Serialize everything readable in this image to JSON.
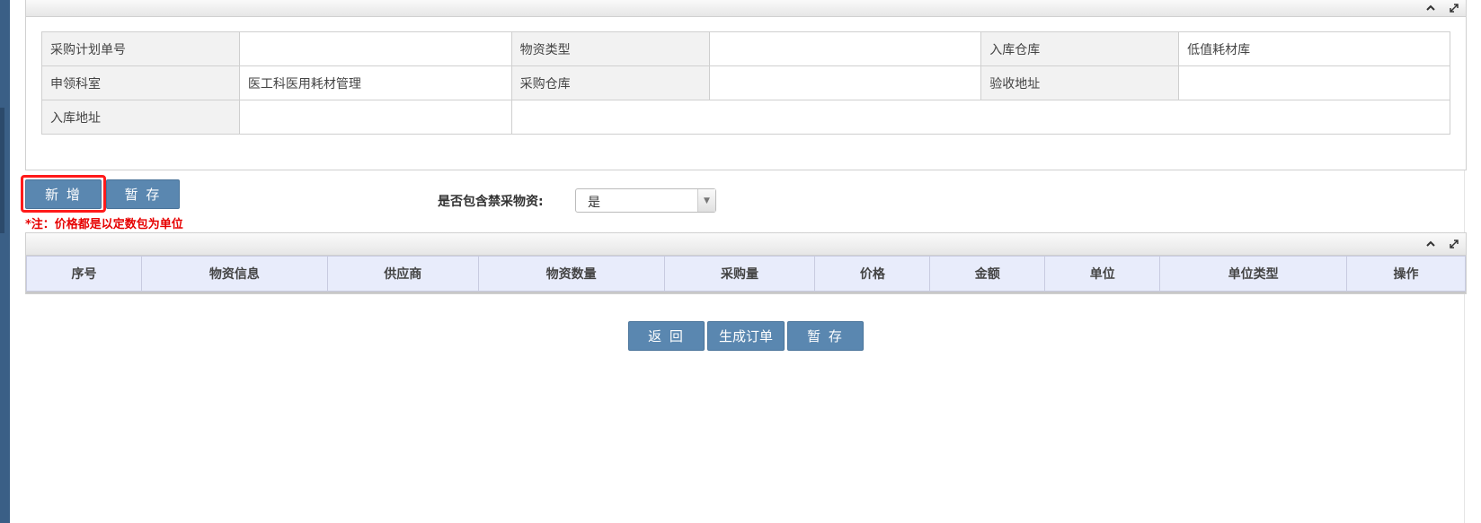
{
  "form": {
    "rows": [
      [
        {
          "label": "采购计划单号",
          "value": ""
        },
        {
          "label": "物资类型",
          "value": ""
        },
        {
          "label": "入库仓库",
          "value": "低值耗材库"
        }
      ],
      [
        {
          "label": "申领科室",
          "value": "医工科医用耗材管理"
        },
        {
          "label": "采购仓库",
          "value": ""
        },
        {
          "label": "验收地址",
          "value": ""
        }
      ],
      [
        {
          "label": "入库地址",
          "value": ""
        }
      ]
    ]
  },
  "toolbar": {
    "add_label": "新 增",
    "save_label": "暂 存",
    "note": "*注：价格都是以定数包为单位",
    "forbidden_label": "是否包含禁采物资:",
    "forbidden_value": "是"
  },
  "grid": {
    "columns": [
      "序号",
      "物资信息",
      "供应商",
      "物资数量",
      "采购量",
      "价格",
      "金额",
      "单位",
      "单位类型",
      "操作"
    ]
  },
  "actions": {
    "back_label": "返 回",
    "order_label": "生成订单",
    "save_label": "暂 存"
  },
  "icons": {
    "collapse": "chevron-up-icon",
    "expand": "expand-icon"
  },
  "colors": {
    "button": "#5a87b0",
    "highlight": "#ff1a1a",
    "note": "#e60000",
    "grid_header": "#e8ecfb"
  }
}
